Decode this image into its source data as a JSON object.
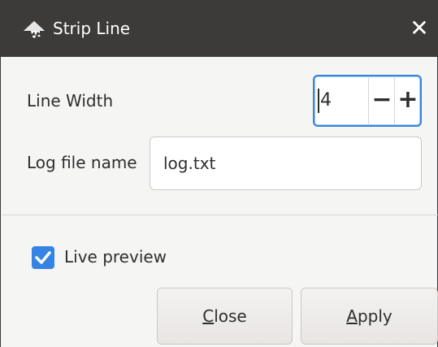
{
  "window": {
    "title": "Strip Line",
    "app_icon": "inkscape-logo-icon",
    "close_icon": "close-icon"
  },
  "form": {
    "line_width_label": "Line Width",
    "line_width_value": "4",
    "decrement_symbol": "−",
    "increment_symbol": "+",
    "log_file_label": "Log file name",
    "log_file_value": "log.txt"
  },
  "options": {
    "live_preview_label": "Live preview",
    "live_preview_checked": true
  },
  "buttons": {
    "close_mnemonic": "C",
    "close_rest": "lose",
    "apply_mnemonic": "A",
    "apply_rest": "pply"
  },
  "colors": {
    "titlebar": "#3d3b39",
    "accent": "#3584e4",
    "background": "#f5f5f4"
  }
}
